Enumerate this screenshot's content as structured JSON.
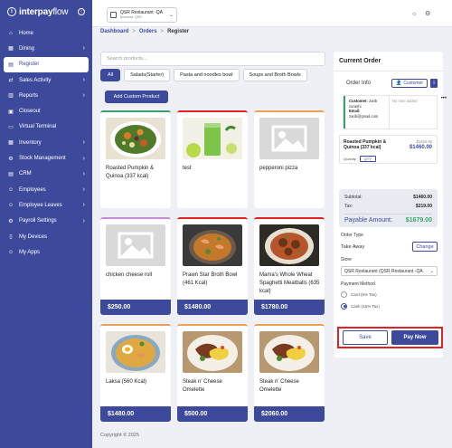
{
  "brand": {
    "name_bold": "interpay",
    "name_light": "flow"
  },
  "colors": {
    "primary": "#3d4a9c",
    "sidebar": "#3d4a9c",
    "success": "#3aa36b",
    "highlight": "#e02424"
  },
  "sidebar": {
    "items": [
      {
        "label": "Home",
        "icon": "home-icon",
        "chevron": false,
        "active": false
      },
      {
        "label": "Dining",
        "icon": "dining-icon",
        "chevron": true,
        "active": false
      },
      {
        "label": "Register",
        "icon": "register-icon",
        "chevron": false,
        "active": true
      },
      {
        "label": "Sales Activity",
        "icon": "sales-icon",
        "chevron": true,
        "active": false
      },
      {
        "label": "Reports",
        "icon": "reports-icon",
        "chevron": true,
        "active": false
      },
      {
        "label": "Closeout",
        "icon": "closeout-icon",
        "chevron": false,
        "active": false
      },
      {
        "label": "Virtual Terminal",
        "icon": "terminal-icon",
        "chevron": false,
        "active": false
      },
      {
        "label": "Inventory",
        "icon": "inventory-icon",
        "chevron": true,
        "active": false
      },
      {
        "label": "Stock Management",
        "icon": "stock-icon",
        "chevron": true,
        "active": false
      },
      {
        "label": "CRM",
        "icon": "crm-icon",
        "chevron": true,
        "active": false
      },
      {
        "label": "Employees",
        "icon": "employees-icon",
        "chevron": true,
        "active": false
      },
      {
        "label": "Employee Leaves",
        "icon": "leaves-icon",
        "chevron": true,
        "active": false
      },
      {
        "label": "Payroll Settings",
        "icon": "payroll-icon",
        "chevron": true,
        "active": false
      },
      {
        "label": "My Devices",
        "icon": "devices-icon",
        "chevron": false,
        "active": false
      },
      {
        "label": "My Apps",
        "icon": "apps-icon",
        "chevron": false,
        "active": false
      }
    ]
  },
  "topbar": {
    "store_name": "QSR Restaurant -QA",
    "store_sub": "Business: QSR"
  },
  "breadcrumb": {
    "dashboard": "Dashboard",
    "orders": "Orders",
    "current": "Register",
    "sep": ">"
  },
  "search": {
    "placeholder": "Search products..."
  },
  "categories": [
    "All",
    "Salads(Starter)",
    "Pasta and noodles bowl",
    "Soups and Broth Bowls"
  ],
  "add_custom_label": "Add Custom Product",
  "products": [
    {
      "name": "Roasted Pumpkin & Quinoa (337 kcal)",
      "price": "",
      "img": "salad",
      "accent": "#3aa36b"
    },
    {
      "name": "test",
      "price": "",
      "img": "juice",
      "accent": "#e02424"
    },
    {
      "name": "pepperoni pizza",
      "price": "",
      "img": "placeholder",
      "accent": "#f0a050"
    },
    {
      "name": "chicken cheese roll",
      "price": "$250.00",
      "img": "placeholder",
      "accent": "#c78bd8"
    },
    {
      "name": "Prawn Star Broth Bowl (461 Kcal)",
      "price": "$1480.00",
      "img": "soup",
      "accent": "#e02424"
    },
    {
      "name": "Mama's Whole Wheat Spaghetti Meatballs (635 kcal)",
      "price": "$1780.00",
      "img": "pasta",
      "accent": "#e02424"
    },
    {
      "name": "Laksa (560 Kcal)",
      "price": "$1480.00",
      "img": "laksa",
      "accent": "#f0a050"
    },
    {
      "name": "Steak n' Cheese Omelette",
      "price": "$500.00",
      "img": "steak",
      "accent": "#f0a050"
    },
    {
      "name": "Steak n' Cheese Omelette",
      "price": "$2060.00",
      "img": "steak",
      "accent": "#f0a050"
    }
  ],
  "copyright": "Copyright © 2025",
  "order": {
    "title": "Current Order",
    "info_label": "Order Info",
    "customer_btn": "Customer",
    "customer_label": "Customer:",
    "customer_name": "zarib zurashi",
    "email_label": "Email:",
    "email": "zarib@gmail.com",
    "note": "No note added",
    "item_name": "Roasted Pumpkin & Quinoa (337 kcal)",
    "item_price_small": "$1460.00",
    "item_price": "$1460.00",
    "qty_label": "Quanity",
    "qty_btn": "QTY",
    "subtotal_label": "Subtotal:",
    "subtotal": "$1460.00",
    "tax_label": "Tax:",
    "tax": "$219.00",
    "payable_label": "Payable Amount:",
    "payable": "$1679.00",
    "order_type_label": "Order Type",
    "order_type": "Take Away",
    "change_btn": "Change",
    "store_label": "Store",
    "store_value": "QSR Restaurant (QSR Restaurant -QA",
    "payment_label": "Payment Method",
    "payment_options": [
      "Card (6% Tax)",
      "Cash (15% Tax)"
    ],
    "save_btn": "Save",
    "pay_btn": "Pay Now"
  }
}
